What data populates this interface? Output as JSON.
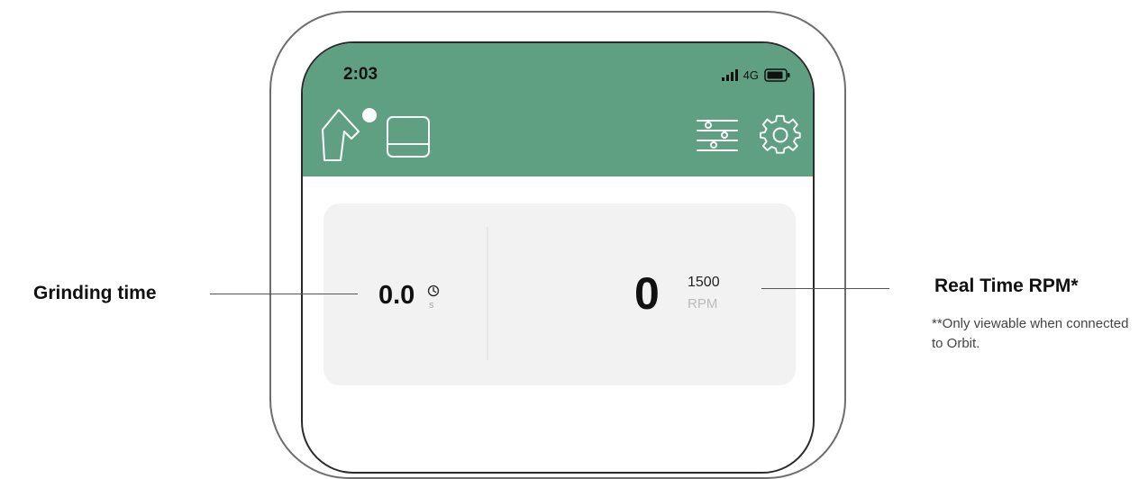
{
  "status_bar": {
    "time": "2:03",
    "network": "4G"
  },
  "header": {
    "icons": [
      "grinder-connected-icon",
      "bin-icon",
      "sliders-icon",
      "gear-icon"
    ]
  },
  "card": {
    "grinding_time_value": "0.0",
    "grinding_time_unit": "s",
    "rpm_value": "0",
    "rpm_target": "1500",
    "rpm_unit": "RPM"
  },
  "annotations": {
    "grinding_time_label": "Grinding time",
    "rpm_label": "Real Time RPM*",
    "rpm_note": "**Only viewable when connected to Orbit."
  },
  "colors": {
    "header_bg": "#5fa083",
    "card_bg": "#f2f2f2"
  }
}
